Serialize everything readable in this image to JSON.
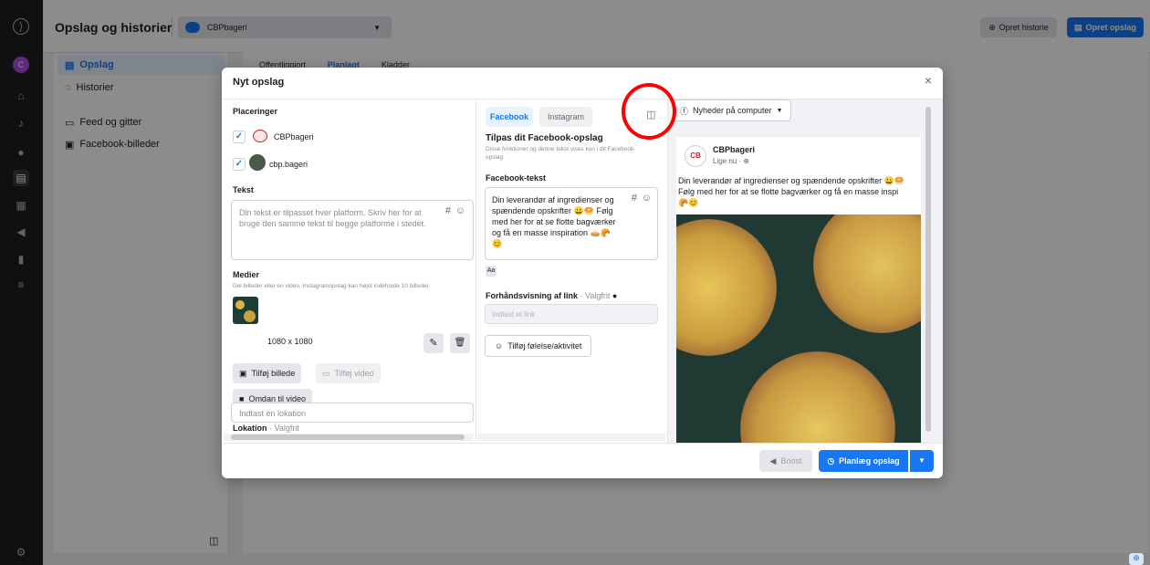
{
  "header": {
    "title": "Opslag og historier",
    "account": "CBPbageri",
    "btn_story": "Opret historie",
    "btn_post": "Opret opslag"
  },
  "sidebar": {
    "items": [
      {
        "label": "Opslag"
      },
      {
        "label": "Historier"
      },
      {
        "label": "Feed og gitter"
      },
      {
        "label": "Facebook-billeder"
      }
    ]
  },
  "bg_tabs": [
    "Offentliggjort",
    "Planlagt",
    "Kladder"
  ],
  "modal": {
    "title": "Nyt opslag",
    "left": {
      "placements_label": "Placeringer",
      "accounts": [
        {
          "name": "CBPbageri"
        },
        {
          "name": "cbp.bageri"
        }
      ],
      "text_label": "Tekst",
      "text_placeholder": "Din tekst er tilpasset hver platform. Skriv her for at bruge den samme tekst til begge platforme i stedet.",
      "media_label": "Medier",
      "media_hint": "Del billeder eller en video. Instagramopslag kan højst indeholde 10 billeder.",
      "media_size": "1080 x 1080",
      "add_photo": "Tilføj billede",
      "add_video": "Tilføj video",
      "to_video": "Omdan til video",
      "location_label": "Lokation",
      "location_optional": "· Valgfrit",
      "location_placeholder": "Indtast en lokation"
    },
    "mid": {
      "tab_fb": "Facebook",
      "tab_ig": "Instagram",
      "customize_title": "Tilpas dit Facebook-opslag",
      "customize_hint": "Disse funktioner og denne tekst vises kun i dit Facebook-opslag.",
      "fb_text_label": "Facebook-tekst",
      "fb_text": "Din leverandør af ingredienser og spændende opskrifter 😀🥯 Følg med her for at se flotte bagværker og få en masse inspiration 🥧🥐😊",
      "link_label": "Forhåndsvisning af link",
      "link_optional": "· Valgfrit",
      "link_placeholder": "Indtast et link",
      "feeling": "Tilføj følelse/aktivitet"
    },
    "right": {
      "preview_select": "Nyheder på computer",
      "page_name": "CBPbageri",
      "time": "Lige nu ·",
      "post_text_1": "Din leverandør af ingredienser og spændende opskrifter 😀🥯",
      "post_text_2": "Følg med her for at se flotte bagværker og få en masse inspi",
      "post_emojis": "🥐😊"
    },
    "footer": {
      "boost": "Boost",
      "schedule": "Planlæg opslag"
    }
  },
  "colors": {
    "accent": "#1877f2",
    "highlight": "#ff0000"
  }
}
